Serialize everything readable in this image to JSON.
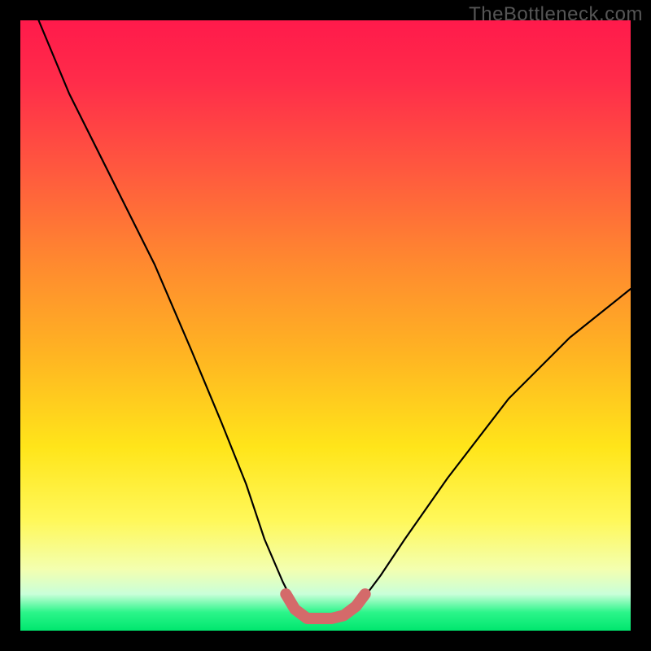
{
  "watermark": "TheBottleneck.com",
  "chart_data": {
    "type": "line",
    "title": "",
    "xlabel": "",
    "ylabel": "",
    "xlim": [
      0,
      100
    ],
    "ylim": [
      0,
      100
    ],
    "series": [
      {
        "name": "bottleneck-curve",
        "x": [
          3,
          8,
          15,
          22,
          28,
          33,
          37,
          40,
          43,
          45,
          47,
          49,
          52,
          54,
          56,
          59,
          63,
          70,
          80,
          90,
          100
        ],
        "y": [
          100,
          88,
          74,
          60,
          46,
          34,
          24,
          15,
          8,
          4,
          2,
          2,
          2,
          3,
          5,
          9,
          15,
          25,
          38,
          48,
          56
        ]
      },
      {
        "name": "optimal-region",
        "x": [
          43.5,
          45,
          47,
          49,
          51,
          53,
          55,
          56.5
        ],
        "y": [
          6,
          3.5,
          2,
          2,
          2,
          2.5,
          4,
          6
        ]
      }
    ],
    "colors": {
      "curve": "#000000",
      "optimal_region": "#d46a6a",
      "gradient_top": "#ff1a4b",
      "gradient_mid": "#ffe51a",
      "gradient_bottom": "#00e66e"
    }
  }
}
